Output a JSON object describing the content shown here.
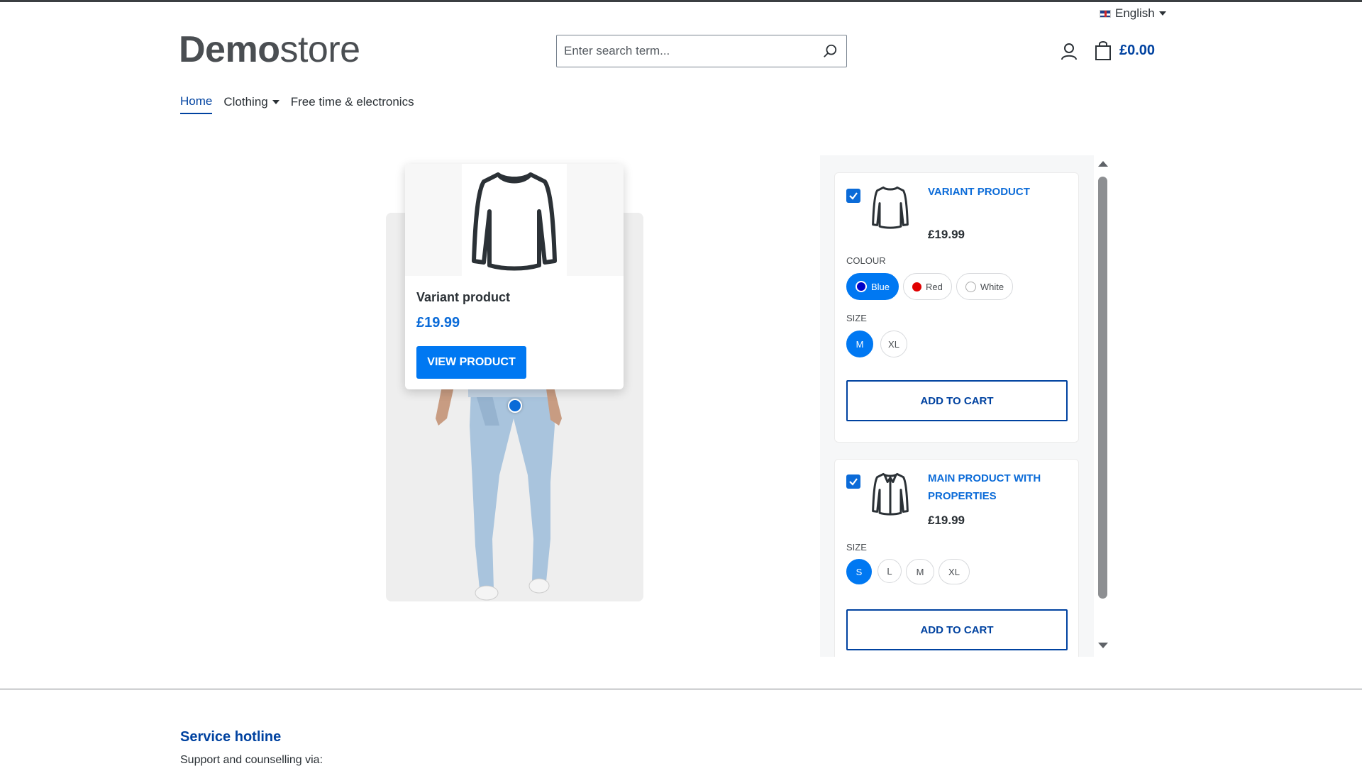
{
  "header": {
    "language": "English",
    "logo_bold": "Demo",
    "logo_light": "store",
    "search_placeholder": "Enter search term...",
    "cart_total": "£0.00"
  },
  "nav": {
    "items": [
      {
        "label": "Home",
        "active": true
      },
      {
        "label": "Clothing",
        "dropdown": true
      },
      {
        "label": "Free time & electronics"
      }
    ]
  },
  "popover": {
    "name": "Variant product",
    "price": "£19.99",
    "button": "VIEW PRODUCT"
  },
  "panel": {
    "items": [
      {
        "title": "VARIANT PRODUCT",
        "price": "£19.99",
        "checked": true,
        "colour_label": "COLOUR",
        "colours": [
          {
            "label": "Blue",
            "color": "#0000c8",
            "selected": true
          },
          {
            "label": "Red",
            "color": "#e00000",
            "selected": false
          },
          {
            "label": "White",
            "color": "#ffffff",
            "selected": false
          }
        ],
        "size_label": "SIZE",
        "sizes": [
          {
            "label": "M",
            "selected": true
          },
          {
            "label": "XL",
            "selected": false
          }
        ],
        "button": "ADD TO CART"
      },
      {
        "title": "MAIN PRODUCT WITH PROPERTIES",
        "price": "£19.99",
        "checked": true,
        "size_label": "SIZE",
        "sizes": [
          {
            "label": "S",
            "selected": true
          },
          {
            "label": "L",
            "selected": false
          },
          {
            "label": "M",
            "selected": false
          },
          {
            "label": "XL",
            "selected": false
          }
        ],
        "button": "ADD TO CART"
      }
    ]
  },
  "footer": {
    "heading": "Service hotline",
    "subtext": "Support and counselling via:"
  },
  "colors": {
    "primary": "#0078f2",
    "brand_dark": "#0042a0",
    "link": "#0b6bd8"
  }
}
